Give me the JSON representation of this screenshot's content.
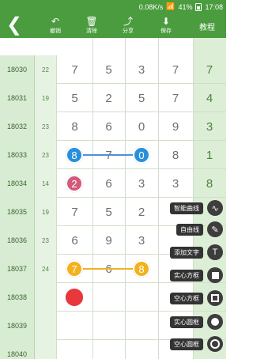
{
  "status": {
    "speed": "0.08K/s",
    "battery": "41%",
    "time": "17:08"
  },
  "toolbar": {
    "items": [
      {
        "icon": "undo-icon",
        "label": "撤销"
      },
      {
        "icon": "trash-icon",
        "label": "清除"
      },
      {
        "icon": "share-icon",
        "label": "分享"
      },
      {
        "icon": "save-icon",
        "label": "保存"
      }
    ],
    "help": "教程"
  },
  "rows": [
    {
      "label": "18030",
      "id": "22",
      "nums": [
        "7",
        "5",
        "3",
        "7"
      ],
      "last": "7"
    },
    {
      "label": "18031",
      "id": "19",
      "nums": [
        "5",
        "2",
        "5",
        "7"
      ],
      "last": "4"
    },
    {
      "label": "18032",
      "id": "23",
      "nums": [
        "8",
        "6",
        "0",
        "9"
      ],
      "last": "3"
    },
    {
      "label": "18033",
      "id": "23",
      "nums": [
        "",
        "7",
        "",
        "8"
      ],
      "last": "1"
    },
    {
      "label": "18034",
      "id": "14",
      "nums": [
        "",
        "6",
        "3",
        "3"
      ],
      "last": "8"
    },
    {
      "label": "18035",
      "id": "19",
      "nums": [
        "7",
        "5",
        "2",
        ""
      ],
      "last": ""
    },
    {
      "label": "18036",
      "id": "23",
      "nums": [
        "6",
        "9",
        "3",
        ""
      ],
      "last": ""
    },
    {
      "label": "18037",
      "id": "24",
      "nums": [
        "",
        "6",
        "",
        ""
      ],
      "last": ""
    },
    {
      "label": "18038",
      "id": "",
      "nums": [
        "",
        "",
        "",
        ""
      ],
      "last": ""
    },
    {
      "label": "18039",
      "id": "",
      "nums": [
        "",
        "",
        "",
        ""
      ],
      "last": ""
    },
    {
      "label": "18040",
      "id": "",
      "nums": [
        "",
        "",
        "",
        ""
      ],
      "last": ""
    }
  ],
  "balls": [
    {
      "row": 3,
      "col": 0,
      "value": "8",
      "color": "blue"
    },
    {
      "row": 3,
      "col": 2,
      "value": "0",
      "color": "blue"
    },
    {
      "row": 4,
      "col": 0,
      "value": "2",
      "color": "pink"
    },
    {
      "row": 7,
      "col": 0,
      "value": "7",
      "color": "orange"
    },
    {
      "row": 7,
      "col": 2,
      "value": "8",
      "color": "orange"
    },
    {
      "row": 8,
      "col": 0,
      "value": "",
      "color": "red"
    }
  ],
  "tools": [
    {
      "label": "智能曲线",
      "icon": "wave-icon"
    },
    {
      "label": "自由线",
      "icon": "pen-icon"
    },
    {
      "label": "添加文字",
      "icon": "text-icon"
    },
    {
      "label": "实心方框",
      "icon": "filled-square-icon"
    },
    {
      "label": "空心方框",
      "icon": "hollow-square-icon"
    },
    {
      "label": "实心圆框",
      "icon": "filled-circle-icon"
    },
    {
      "label": "空心圆框",
      "icon": "hollow-circle-icon"
    }
  ]
}
